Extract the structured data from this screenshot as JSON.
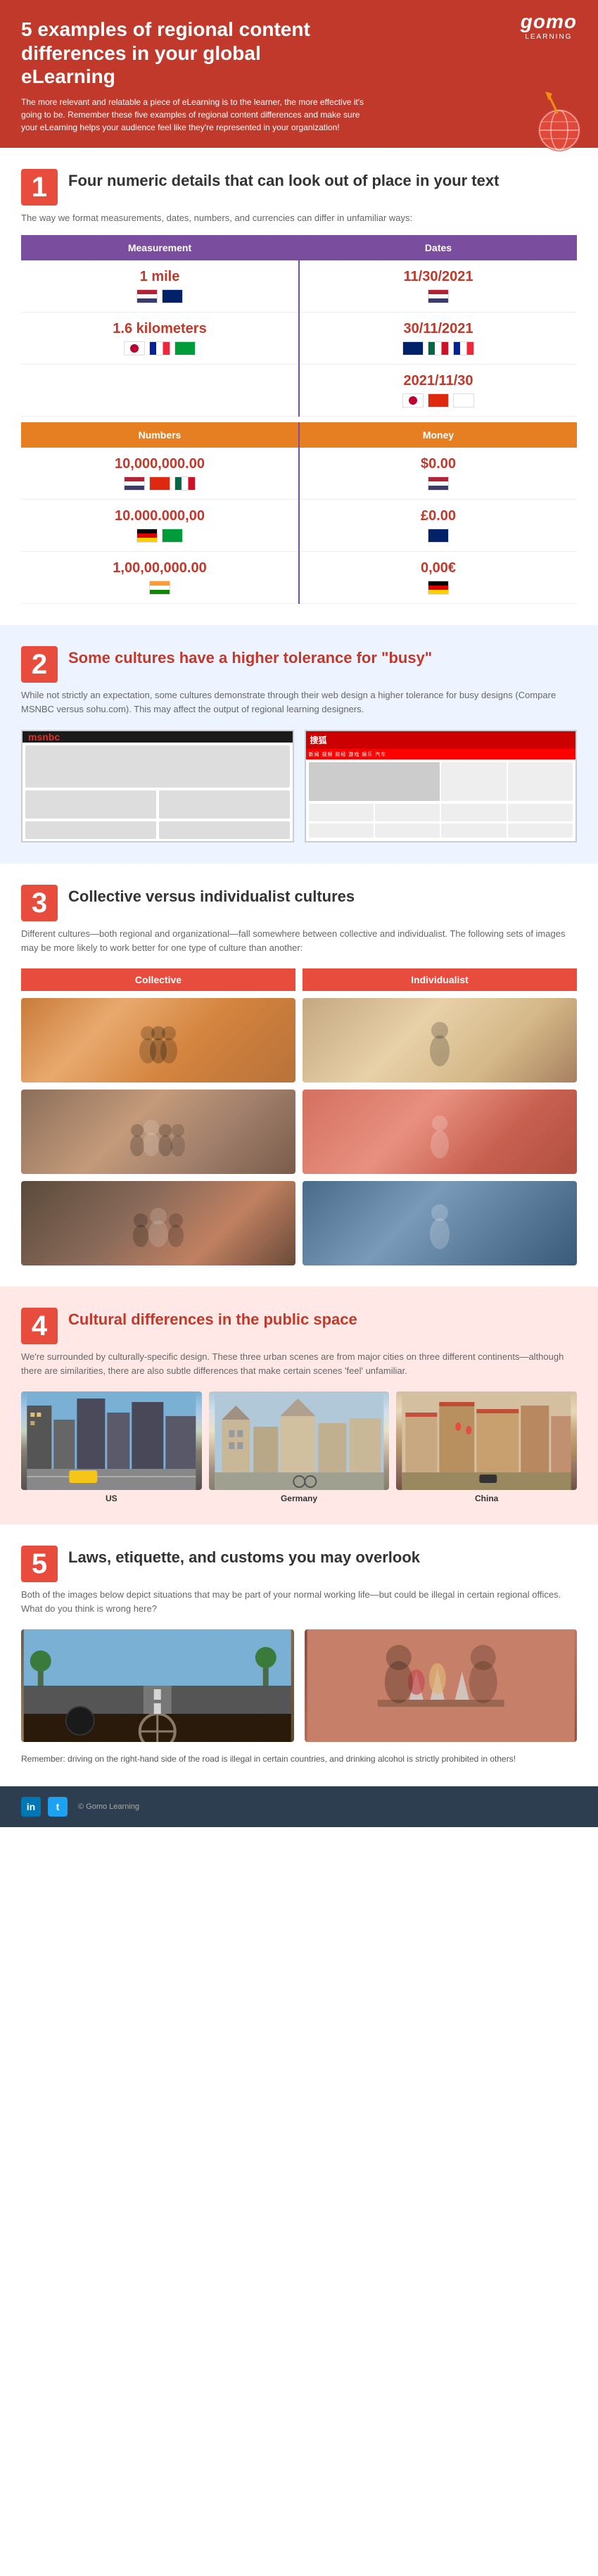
{
  "header": {
    "logo": "gomo",
    "logo_sub": "LEARNING",
    "title": "5 examples of regional content differences in your global eLearning",
    "intro": "The more relevant and relatable a piece of eLearning is to the learner, the more effective it's going to be. Remember these five examples of regional content differences and make sure your eLearning helps your audience feel like they're represented in your organization!"
  },
  "section1": {
    "number": "1",
    "title": "Four numeric details that can look out of place in your text",
    "subtitle": "The way we format measurements, dates, numbers, and currencies can differ in unfamiliar ways:",
    "table": {
      "col1_header": "Measurement",
      "col2_header": "Dates",
      "rows": [
        {
          "left_value": "1 mile",
          "left_flags": [
            "us",
            "uk"
          ],
          "right_value": "11/30/2021",
          "right_flags": [
            "us"
          ]
        },
        {
          "left_value": "1.6 kilometers",
          "left_flags": [
            "jp",
            "fr",
            "br"
          ],
          "right_value": "30/11/2021",
          "right_flags": [
            "uk",
            "mx",
            "fr"
          ]
        },
        {
          "left_value": "",
          "left_flags": [],
          "right_value": "2021/11/30",
          "right_flags": [
            "jp",
            "cn",
            "kr"
          ]
        }
      ],
      "col3_header": "Numbers",
      "col4_header": "Money",
      "rows2": [
        {
          "left_value": "10,000,000.00",
          "left_flags": [
            "us",
            "cn",
            "mx"
          ],
          "right_value": "$0.00",
          "right_flags": [
            "us"
          ]
        },
        {
          "left_value": "10.000.000,00",
          "left_flags": [
            "de",
            "br"
          ],
          "right_value": "£0.00",
          "right_flags": [
            "uk"
          ]
        },
        {
          "left_value": "1,00,00,000.00",
          "left_flags": [
            "in"
          ],
          "right_value": "0,00€",
          "right_flags": [
            "de"
          ]
        }
      ]
    }
  },
  "section2": {
    "number": "2",
    "title": "Some cultures have a higher tolerance for \"busy\"",
    "subtitle": "While not strictly an expectation, some cultures demonstrate through their web design a higher tolerance for busy designs (Compare MSNBC versus sohu.com). This may affect the output of regional learning designers.",
    "img1_label": "MSNBC",
    "img2_label": "sohu.com"
  },
  "section3": {
    "number": "3",
    "title": "Collective versus individualist cultures",
    "subtitle": "Different cultures—both regional and organizational—fall somewhere between collective and individualist. The following sets of images may be more likely to work better for one type of culture than another:",
    "col1_label": "Collective",
    "col2_label": "Individualist"
  },
  "section4": {
    "number": "4",
    "title": "Cultural differences in the public space",
    "subtitle": "We're surrounded by culturally-specific design. These three urban scenes are from major cities on three different continents—although there are similarities, there are also subtle differences that make certain scenes 'feel' unfamiliar.",
    "labels": [
      "US",
      "Germany",
      "China"
    ]
  },
  "section5": {
    "number": "5",
    "title": "Laws, etiquette, and customs you may overlook",
    "subtitle": "Both of the images below depict situations that may be part of your normal working life—but could be illegal in certain regional offices. What do you think is wrong here?",
    "note": "Remember: driving on the right-hand side of the road is illegal in certain countries, and drinking alcohol is strictly prohibited in others!"
  },
  "footer": {
    "copyright": "© Gomo Learning"
  }
}
